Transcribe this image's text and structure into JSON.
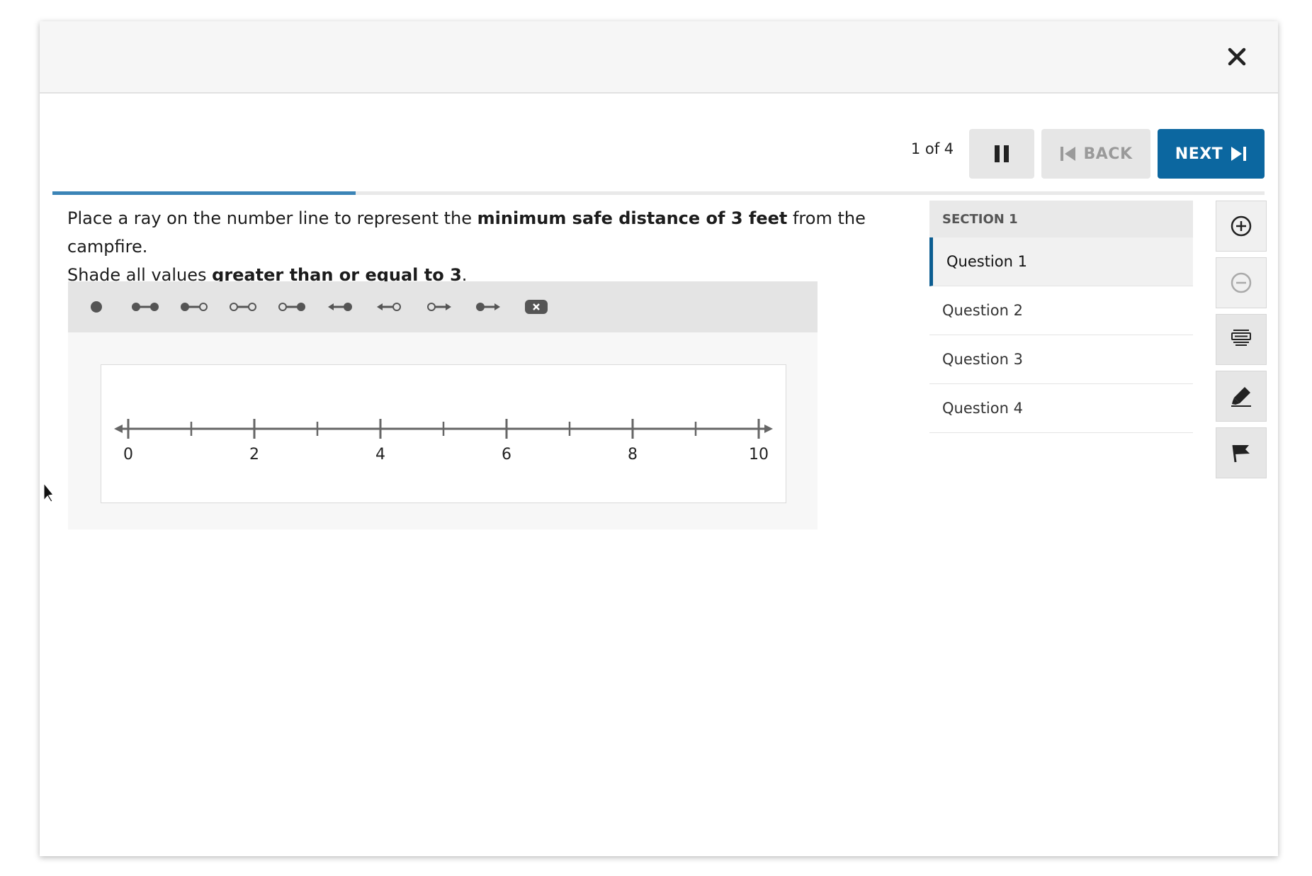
{
  "header": {
    "close_icon": "close-icon"
  },
  "nav": {
    "counter": "1 of 4",
    "pause_icon": "pause-icon",
    "back_label": "BACK",
    "next_label": "NEXT",
    "progress_fraction": 0.25
  },
  "prompt": {
    "line1_pre": "Place a ray on the number line to represent the ",
    "line1_bold": "minimum safe distance of 3 feet",
    "line1_post": " from the campfire.",
    "line2_pre": "Shade all values ",
    "line2_bold": "greater than or equal to 3",
    "line2_post": "."
  },
  "tools": [
    "point-tool-icon",
    "closed-closed-segment-icon",
    "closed-open-segment-icon",
    "open-open-segment-icon",
    "open-closed-segment-icon",
    "left-ray-closed-icon",
    "left-ray-open-icon",
    "right-ray-open-icon",
    "right-ray-closed-icon",
    "delete-icon"
  ],
  "number_line": {
    "min": 0,
    "max": 10,
    "tick_step": 1,
    "labels": [
      "0",
      "2",
      "4",
      "6",
      "8",
      "10"
    ]
  },
  "section": {
    "title": "SECTION 1",
    "questions": [
      "Question 1",
      "Question 2",
      "Question 3",
      "Question 4"
    ],
    "active_index": 0
  },
  "side_tools": [
    "zoom-in-icon",
    "zoom-out-icon",
    "line-reader-icon",
    "highlighter-icon",
    "flag-icon"
  ],
  "colors": {
    "accent": "#0c67a0",
    "progress": "#3b84b6"
  }
}
